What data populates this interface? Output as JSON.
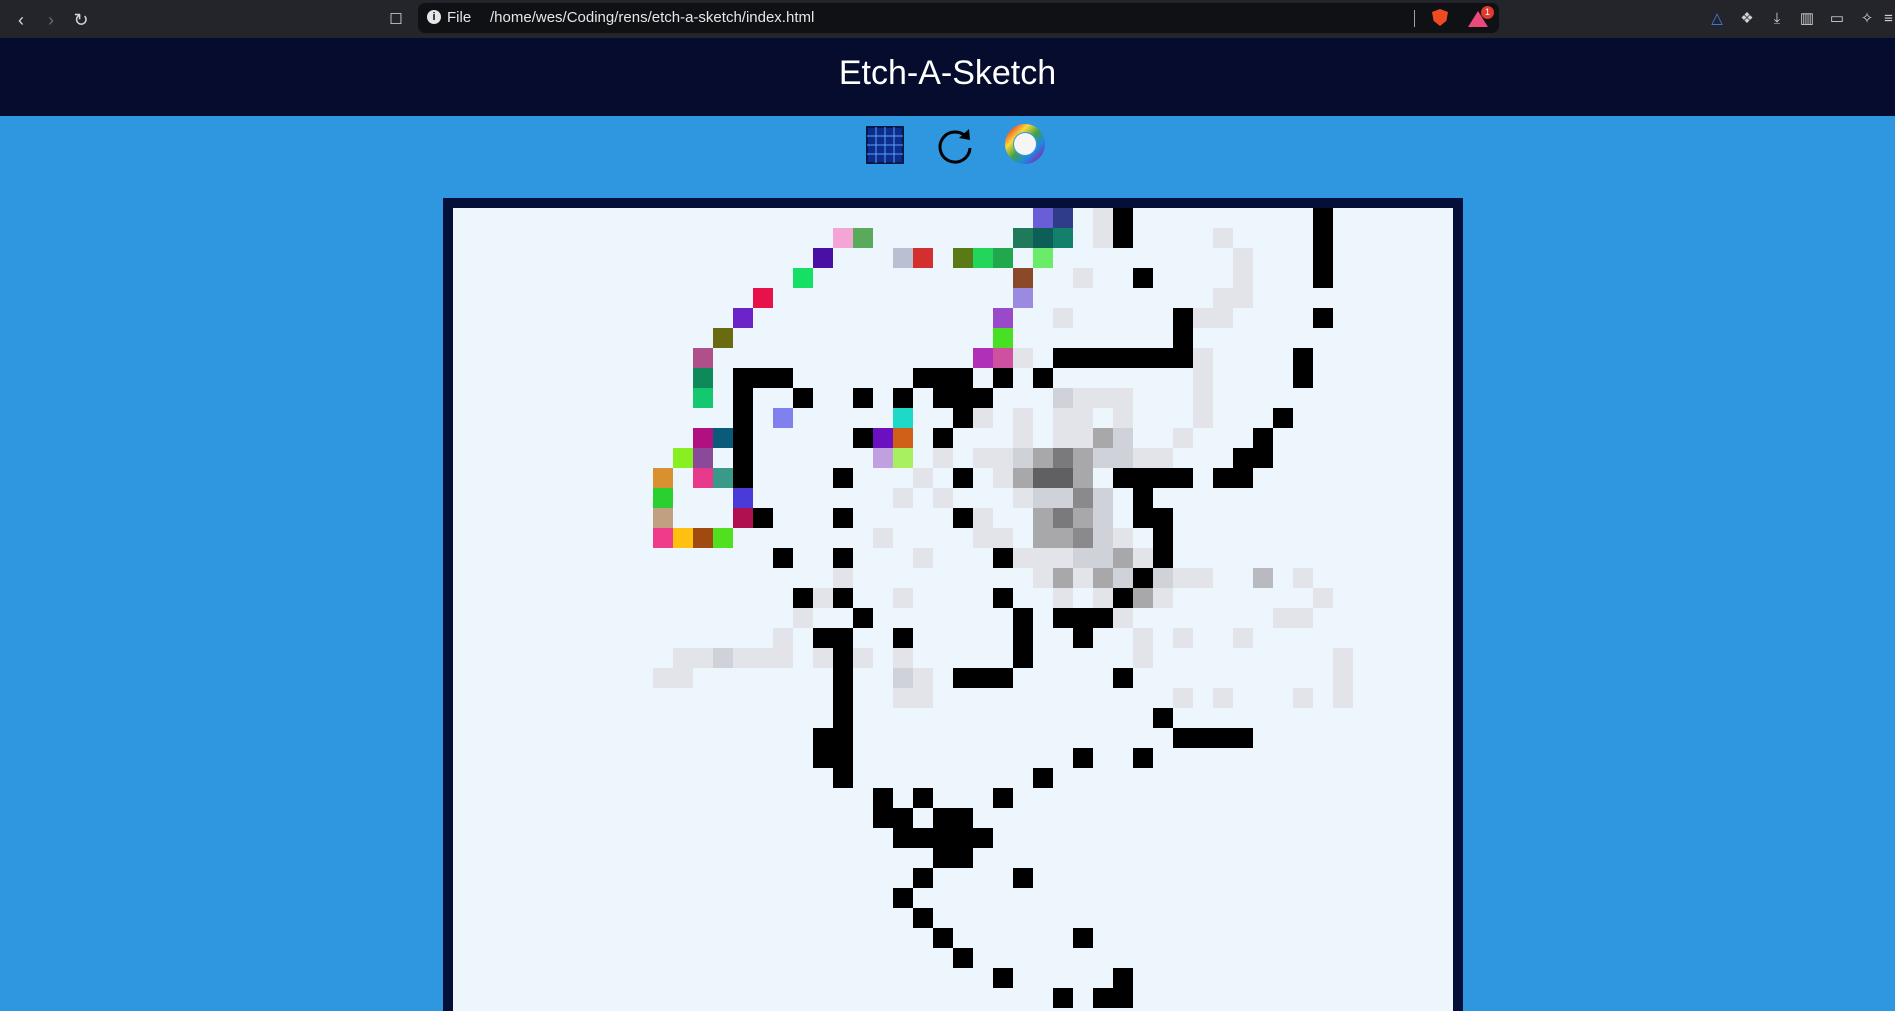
{
  "browser": {
    "url_scheme": "File",
    "url_path": "/home/wes/Coding/rens/etch-a-sketch/index.html",
    "rewards_count": "1"
  },
  "app": {
    "title": "Etch-A-Sketch"
  },
  "controls": {
    "grid_icon": "grid-icon",
    "reset_icon": "reset-icon",
    "color_icon": "color-wheel-icon"
  },
  "board": {
    "background": "#eef6fd",
    "frame_color": "#05103a",
    "cells": [
      [
        "#6a5ed8",
        29,
        0
      ],
      [
        "#2f3c8a",
        30,
        0
      ],
      [
        "#e2e4ea",
        32,
        0
      ],
      [
        "#000000",
        33,
        0
      ],
      [
        "#000000",
        43,
        0
      ],
      [
        "#f3a6d6",
        19,
        1
      ],
      [
        "#5aaa5c",
        20,
        1
      ],
      [
        "#1f7a5c",
        28,
        1
      ],
      [
        "#0d5e57",
        29,
        1
      ],
      [
        "#12806a",
        30,
        1
      ],
      [
        "#e2e4ea",
        32,
        1
      ],
      [
        "#000000",
        33,
        1
      ],
      [
        "#e2e4ea",
        38,
        1
      ],
      [
        "#000000",
        43,
        1
      ],
      [
        "#4a0fa3",
        18,
        2
      ],
      [
        "#b8c0d2",
        22,
        2
      ],
      [
        "#d32f2f",
        23,
        2
      ],
      [
        "#5a7a16",
        25,
        2
      ],
      [
        "#22d65c",
        26,
        2
      ],
      [
        "#22a84c",
        27,
        2
      ],
      [
        "#6aec6a",
        29,
        2
      ],
      [
        "#e2e4ea",
        39,
        2
      ],
      [
        "#000000",
        43,
        2
      ],
      [
        "#15e065",
        17,
        3
      ],
      [
        "#8a4a2a",
        28,
        3
      ],
      [
        "#e2e4ea",
        31,
        3
      ],
      [
        "#000000",
        34,
        3
      ],
      [
        "#e2e4ea",
        39,
        3
      ],
      [
        "#000000",
        43,
        3
      ],
      [
        "#e8124a",
        15,
        4
      ],
      [
        "#9a8ae0",
        28,
        4
      ],
      [
        "#e2e4ea",
        38,
        4
      ],
      [
        "#e2e4ea",
        39,
        4
      ],
      [
        "#6a24c8",
        14,
        5
      ],
      [
        "#9a4ac8",
        27,
        5
      ],
      [
        "#e2e4ea",
        30,
        5
      ],
      [
        "#000000",
        36,
        5
      ],
      [
        "#e2e4ea",
        37,
        5
      ],
      [
        "#e2e4ea",
        38,
        5
      ],
      [
        "#000000",
        43,
        5
      ],
      [
        "#6a6a10",
        13,
        6
      ],
      [
        "#48e024",
        27,
        6
      ],
      [
        "#000000",
        36,
        6
      ],
      [
        "#b0508a",
        12,
        7
      ],
      [
        "#b030b8",
        26,
        7
      ],
      [
        "#d050a0",
        27,
        7
      ],
      [
        "#e2e4ea",
        28,
        7
      ],
      [
        "#000000",
        30,
        7
      ],
      [
        "#000000",
        31,
        7
      ],
      [
        "#000000",
        32,
        7
      ],
      [
        "#000000",
        33,
        7
      ],
      [
        "#000000",
        34,
        7
      ],
      [
        "#000000",
        35,
        7
      ],
      [
        "#000000",
        36,
        7
      ],
      [
        "#e2e4ea",
        37,
        7
      ],
      [
        "#000000",
        42,
        7
      ],
      [
        "#0e8a5a",
        12,
        8
      ],
      [
        "#000000",
        14,
        8
      ],
      [
        "#000000",
        15,
        8
      ],
      [
        "#000000",
        16,
        8
      ],
      [
        "#000000",
        23,
        8
      ],
      [
        "#000000",
        24,
        8
      ],
      [
        "#000000",
        25,
        8
      ],
      [
        "#000000",
        27,
        8
      ],
      [
        "#000000",
        29,
        8
      ],
      [
        "#e2e4ea",
        37,
        8
      ],
      [
        "#000000",
        42,
        8
      ],
      [
        "#14c870",
        12,
        9
      ],
      [
        "#000000",
        14,
        9
      ],
      [
        "#000000",
        17,
        9
      ],
      [
        "#000000",
        20,
        9
      ],
      [
        "#000000",
        22,
        9
      ],
      [
        "#000000",
        24,
        9
      ],
      [
        "#000000",
        25,
        9
      ],
      [
        "#000000",
        26,
        9
      ],
      [
        "#cfd2d8",
        30,
        9
      ],
      [
        "#e2e4ea",
        31,
        9
      ],
      [
        "#e2e4ea",
        32,
        9
      ],
      [
        "#e2e4ea",
        33,
        9
      ],
      [
        "#e2e4ea",
        37,
        9
      ],
      [
        "#000000",
        14,
        10
      ],
      [
        "#8080ee",
        16,
        10
      ],
      [
        "#1ed8c8",
        22,
        10
      ],
      [
        "#000000",
        25,
        10
      ],
      [
        "#e2e4ea",
        26,
        10
      ],
      [
        "#e2e4ea",
        28,
        10
      ],
      [
        "#e2e4ea",
        30,
        10
      ],
      [
        "#e2e4ea",
        31,
        10
      ],
      [
        "#e2e4ea",
        33,
        10
      ],
      [
        "#e2e4ea",
        37,
        10
      ],
      [
        "#000000",
        41,
        10
      ],
      [
        "#b01080",
        12,
        11
      ],
      [
        "#0a5a7a",
        13,
        11
      ],
      [
        "#000000",
        14,
        11
      ],
      [
        "#000000",
        20,
        11
      ],
      [
        "#6a10c0",
        21,
        11
      ],
      [
        "#d06018",
        22,
        11
      ],
      [
        "#000000",
        24,
        11
      ],
      [
        "#e2e4ea",
        28,
        11
      ],
      [
        "#e2e4ea",
        30,
        11
      ],
      [
        "#e2e4ea",
        31,
        11
      ],
      [
        "#a8a8aa",
        32,
        11
      ],
      [
        "#cfd2d8",
        33,
        11
      ],
      [
        "#e2e4ea",
        36,
        11
      ],
      [
        "#000000",
        40,
        11
      ],
      [
        "#88f020",
        11,
        12
      ],
      [
        "#8a4a9a",
        12,
        12
      ],
      [
        "#000000",
        14,
        12
      ],
      [
        "#c0a0e0",
        21,
        12
      ],
      [
        "#a8f060",
        22,
        12
      ],
      [
        "#e2e4ea",
        24,
        12
      ],
      [
        "#e2e4ea",
        26,
        12
      ],
      [
        "#e2e4ea",
        27,
        12
      ],
      [
        "#cfd2d8",
        28,
        12
      ],
      [
        "#a8a8aa",
        29,
        12
      ],
      [
        "#7a7a7c",
        30,
        12
      ],
      [
        "#a8a8aa",
        31,
        12
      ],
      [
        "#cfd2d8",
        32,
        12
      ],
      [
        "#cfd2d8",
        33,
        12
      ],
      [
        "#e2e4ea",
        34,
        12
      ],
      [
        "#e2e4ea",
        35,
        12
      ],
      [
        "#000000",
        39,
        12
      ],
      [
        "#000000",
        40,
        12
      ],
      [
        "#d89030",
        10,
        13
      ],
      [
        "#e83a8a",
        12,
        13
      ],
      [
        "#3a9a8a",
        13,
        13
      ],
      [
        "#000000",
        14,
        13
      ],
      [
        "#000000",
        19,
        13
      ],
      [
        "#e2e4ea",
        23,
        13
      ],
      [
        "#000000",
        25,
        13
      ],
      [
        "#e2e4ea",
        27,
        13
      ],
      [
        "#a8a8aa",
        28,
        13
      ],
      [
        "#606062",
        29,
        13
      ],
      [
        "#606062",
        30,
        13
      ],
      [
        "#a8a8aa",
        31,
        13
      ],
      [
        "#000000",
        33,
        13
      ],
      [
        "#000000",
        34,
        13
      ],
      [
        "#000000",
        35,
        13
      ],
      [
        "#000000",
        36,
        13
      ],
      [
        "#000000",
        38,
        13
      ],
      [
        "#000000",
        39,
        13
      ],
      [
        "#2ad030",
        10,
        14
      ],
      [
        "#4a3ad8",
        14,
        14
      ],
      [
        "#e2e4ea",
        22,
        14
      ],
      [
        "#e2e4ea",
        24,
        14
      ],
      [
        "#e2e4ea",
        28,
        14
      ],
      [
        "#cfd2d8",
        29,
        14
      ],
      [
        "#cfd2d8",
        30,
        14
      ],
      [
        "#8a8a8c",
        31,
        14
      ],
      [
        "#cfd2d8",
        32,
        14
      ],
      [
        "#000000",
        34,
        14
      ],
      [
        "#c0a080",
        10,
        15
      ],
      [
        "#b01050",
        14,
        15
      ],
      [
        "#000000",
        15,
        15
      ],
      [
        "#000000",
        19,
        15
      ],
      [
        "#000000",
        25,
        15
      ],
      [
        "#e2e4ea",
        26,
        15
      ],
      [
        "#a8a8aa",
        29,
        15
      ],
      [
        "#7a7a7c",
        30,
        15
      ],
      [
        "#a8a8aa",
        31,
        15
      ],
      [
        "#cfd2d8",
        32,
        15
      ],
      [
        "#000000",
        34,
        15
      ],
      [
        "#000000",
        35,
        15
      ],
      [
        "#f03a8a",
        10,
        16
      ],
      [
        "#ffc010",
        11,
        16
      ],
      [
        "#a04a10",
        12,
        16
      ],
      [
        "#50e020",
        13,
        16
      ],
      [
        "#e2e4ea",
        21,
        16
      ],
      [
        "#e2e4ea",
        26,
        16
      ],
      [
        "#e2e4ea",
        27,
        16
      ],
      [
        "#a8a8aa",
        29,
        16
      ],
      [
        "#a8a8aa",
        30,
        16
      ],
      [
        "#8a8a8c",
        31,
        16
      ],
      [
        "#cfd2d8",
        32,
        16
      ],
      [
        "#e2e4ea",
        33,
        16
      ],
      [
        "#000000",
        35,
        16
      ],
      [
        "#000000",
        16,
        17
      ],
      [
        "#000000",
        19,
        17
      ],
      [
        "#e2e4ea",
        23,
        17
      ],
      [
        "#000000",
        27,
        17
      ],
      [
        "#e2e4ea",
        28,
        17
      ],
      [
        "#e2e4ea",
        29,
        17
      ],
      [
        "#e2e4ea",
        30,
        17
      ],
      [
        "#cfd2d8",
        31,
        17
      ],
      [
        "#cfd2d8",
        32,
        17
      ],
      [
        "#a8a8aa",
        33,
        17
      ],
      [
        "#e2e4ea",
        34,
        17
      ],
      [
        "#000000",
        35,
        17
      ],
      [
        "#e2e4ea",
        19,
        18
      ],
      [
        "#e2e4ea",
        29,
        18
      ],
      [
        "#a8a8aa",
        30,
        18
      ],
      [
        "#e2e4ea",
        31,
        18
      ],
      [
        "#a8a8aa",
        32,
        18
      ],
      [
        "#cfd2d8",
        33,
        18
      ],
      [
        "#000000",
        34,
        18
      ],
      [
        "#cfd2d8",
        35,
        18
      ],
      [
        "#e2e4ea",
        36,
        18
      ],
      [
        "#e2e4ea",
        37,
        18
      ],
      [
        "#b8bac0",
        40,
        18
      ],
      [
        "#e2e4ea",
        42,
        18
      ],
      [
        "#000000",
        17,
        19
      ],
      [
        "#e2e4ea",
        18,
        19
      ],
      [
        "#000000",
        19,
        19
      ],
      [
        "#e2e4ea",
        22,
        19
      ],
      [
        "#000000",
        27,
        19
      ],
      [
        "#e2e4ea",
        30,
        19
      ],
      [
        "#e2e4ea",
        32,
        19
      ],
      [
        "#000000",
        33,
        19
      ],
      [
        "#a8a8aa",
        34,
        19
      ],
      [
        "#e2e4ea",
        35,
        19
      ],
      [
        "#e2e4ea",
        43,
        19
      ],
      [
        "#e2e4ea",
        17,
        20
      ],
      [
        "#000000",
        20,
        20
      ],
      [
        "#000000",
        28,
        20
      ],
      [
        "#000000",
        30,
        20
      ],
      [
        "#000000",
        31,
        20
      ],
      [
        "#000000",
        32,
        20
      ],
      [
        "#e2e4ea",
        33,
        20
      ],
      [
        "#e2e4ea",
        41,
        20
      ],
      [
        "#e2e4ea",
        42,
        20
      ],
      [
        "#e2e4ea",
        16,
        21
      ],
      [
        "#000000",
        18,
        21
      ],
      [
        "#000000",
        19,
        21
      ],
      [
        "#000000",
        22,
        21
      ],
      [
        "#000000",
        28,
        21
      ],
      [
        "#000000",
        31,
        21
      ],
      [
        "#e2e4ea",
        34,
        21
      ],
      [
        "#e2e4ea",
        36,
        21
      ],
      [
        "#e2e4ea",
        39,
        21
      ],
      [
        "#e2e4ea",
        11,
        22
      ],
      [
        "#e2e4ea",
        12,
        22
      ],
      [
        "#cfd2d8",
        13,
        22
      ],
      [
        "#e2e4ea",
        14,
        22
      ],
      [
        "#e2e4ea",
        15,
        22
      ],
      [
        "#e2e4ea",
        16,
        22
      ],
      [
        "#e2e4ea",
        18,
        22
      ],
      [
        "#000000",
        19,
        22
      ],
      [
        "#e2e4ea",
        20,
        22
      ],
      [
        "#e2e4ea",
        22,
        22
      ],
      [
        "#000000",
        28,
        22
      ],
      [
        "#e2e4ea",
        34,
        22
      ],
      [
        "#e2e4ea",
        44,
        22
      ],
      [
        "#e2e4ea",
        10,
        23
      ],
      [
        "#e2e4ea",
        11,
        23
      ],
      [
        "#000000",
        19,
        23
      ],
      [
        "#cfd2d8",
        22,
        23
      ],
      [
        "#e2e4ea",
        23,
        23
      ],
      [
        "#000000",
        25,
        23
      ],
      [
        "#000000",
        26,
        23
      ],
      [
        "#000000",
        27,
        23
      ],
      [
        "#000000",
        33,
        23
      ],
      [
        "#e2e4ea",
        44,
        23
      ],
      [
        "#000000",
        19,
        24
      ],
      [
        "#e2e4ea",
        22,
        24
      ],
      [
        "#e2e4ea",
        23,
        24
      ],
      [
        "#e2e4ea",
        36,
        24
      ],
      [
        "#e2e4ea",
        38,
        24
      ],
      [
        "#e2e4ea",
        42,
        24
      ],
      [
        "#e2e4ea",
        44,
        24
      ],
      [
        "#000000",
        19,
        25
      ],
      [
        "#000000",
        35,
        25
      ],
      [
        "#000000",
        18,
        26
      ],
      [
        "#000000",
        19,
        26
      ],
      [
        "#000000",
        36,
        26
      ],
      [
        "#000000",
        37,
        26
      ],
      [
        "#000000",
        38,
        26
      ],
      [
        "#000000",
        39,
        26
      ],
      [
        "#000000",
        18,
        27
      ],
      [
        "#000000",
        19,
        27
      ],
      [
        "#000000",
        31,
        27
      ],
      [
        "#000000",
        34,
        27
      ],
      [
        "#000000",
        19,
        28
      ],
      [
        "#000000",
        29,
        28
      ],
      [
        "#000000",
        21,
        29
      ],
      [
        "#000000",
        23,
        29
      ],
      [
        "#000000",
        27,
        29
      ],
      [
        "#000000",
        21,
        30
      ],
      [
        "#000000",
        22,
        30
      ],
      [
        "#000000",
        24,
        30
      ],
      [
        "#000000",
        25,
        30
      ],
      [
        "#000000",
        22,
        31
      ],
      [
        "#000000",
        23,
        31
      ],
      [
        "#000000",
        24,
        31
      ],
      [
        "#000000",
        25,
        31
      ],
      [
        "#000000",
        26,
        31
      ],
      [
        "#000000",
        24,
        32
      ],
      [
        "#000000",
        25,
        32
      ],
      [
        "#000000",
        23,
        33
      ],
      [
        "#000000",
        28,
        33
      ],
      [
        "#000000",
        22,
        34
      ],
      [
        "#000000",
        23,
        35
      ],
      [
        "#000000",
        24,
        36
      ],
      [
        "#000000",
        31,
        36
      ],
      [
        "#000000",
        25,
        37
      ],
      [
        "#000000",
        27,
        38
      ],
      [
        "#000000",
        33,
        38
      ],
      [
        "#000000",
        30,
        39
      ],
      [
        "#000000",
        32,
        39
      ],
      [
        "#000000",
        33,
        39
      ]
    ]
  }
}
